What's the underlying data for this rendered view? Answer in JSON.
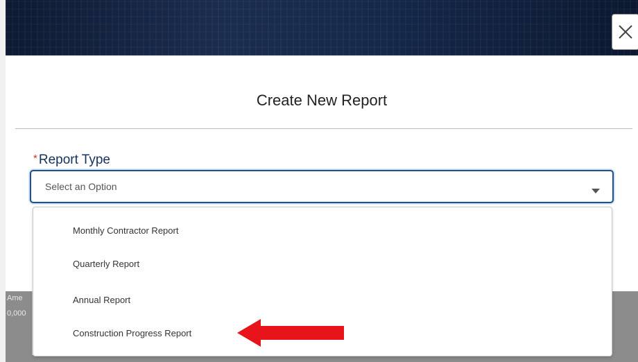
{
  "dialog": {
    "title": "Create New Report",
    "close_icon": "close-icon"
  },
  "report_type": {
    "label": "Report Type",
    "required_marker": "*",
    "placeholder": "Select an Option",
    "caret_icon": "caret-down-icon",
    "options": [
      "Monthly Contractor Report",
      "Quarterly Report",
      "Annual Report",
      "Construction Progress Report"
    ]
  },
  "background": {
    "left_text_1": "Ame",
    "left_text_2": "0,000"
  },
  "annotation": {
    "arrow_icon": "red-arrow-icon",
    "arrow_color": "#e8141c"
  },
  "colors": {
    "header_band": "#15284a",
    "label_color": "#16325c",
    "select_border": "#1b5297",
    "required": "#c23934"
  }
}
